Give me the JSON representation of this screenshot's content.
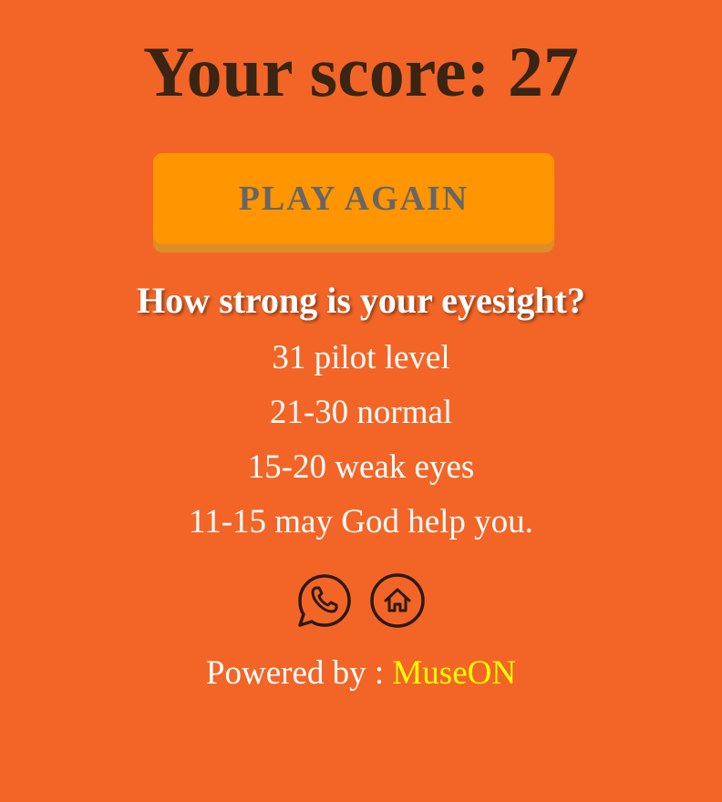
{
  "score": {
    "title": "Your score: 27"
  },
  "actions": {
    "play_again_label": "PLAY AGAIN"
  },
  "eyesight": {
    "question": "How strong is your eyesight?",
    "levels": [
      "31 pilot level",
      "21-30 normal",
      "15-20 weak eyes",
      "11-15 may God help you."
    ]
  },
  "share": {
    "icons": [
      "whatsapp-icon",
      "home-icon"
    ]
  },
  "footer": {
    "powered_by_label": "Powered by : ",
    "brand_name": "MuseON"
  },
  "colors": {
    "background": "#F36526",
    "button": "#FF9500",
    "brand": "#FFFF00",
    "title": "#3A2413"
  }
}
